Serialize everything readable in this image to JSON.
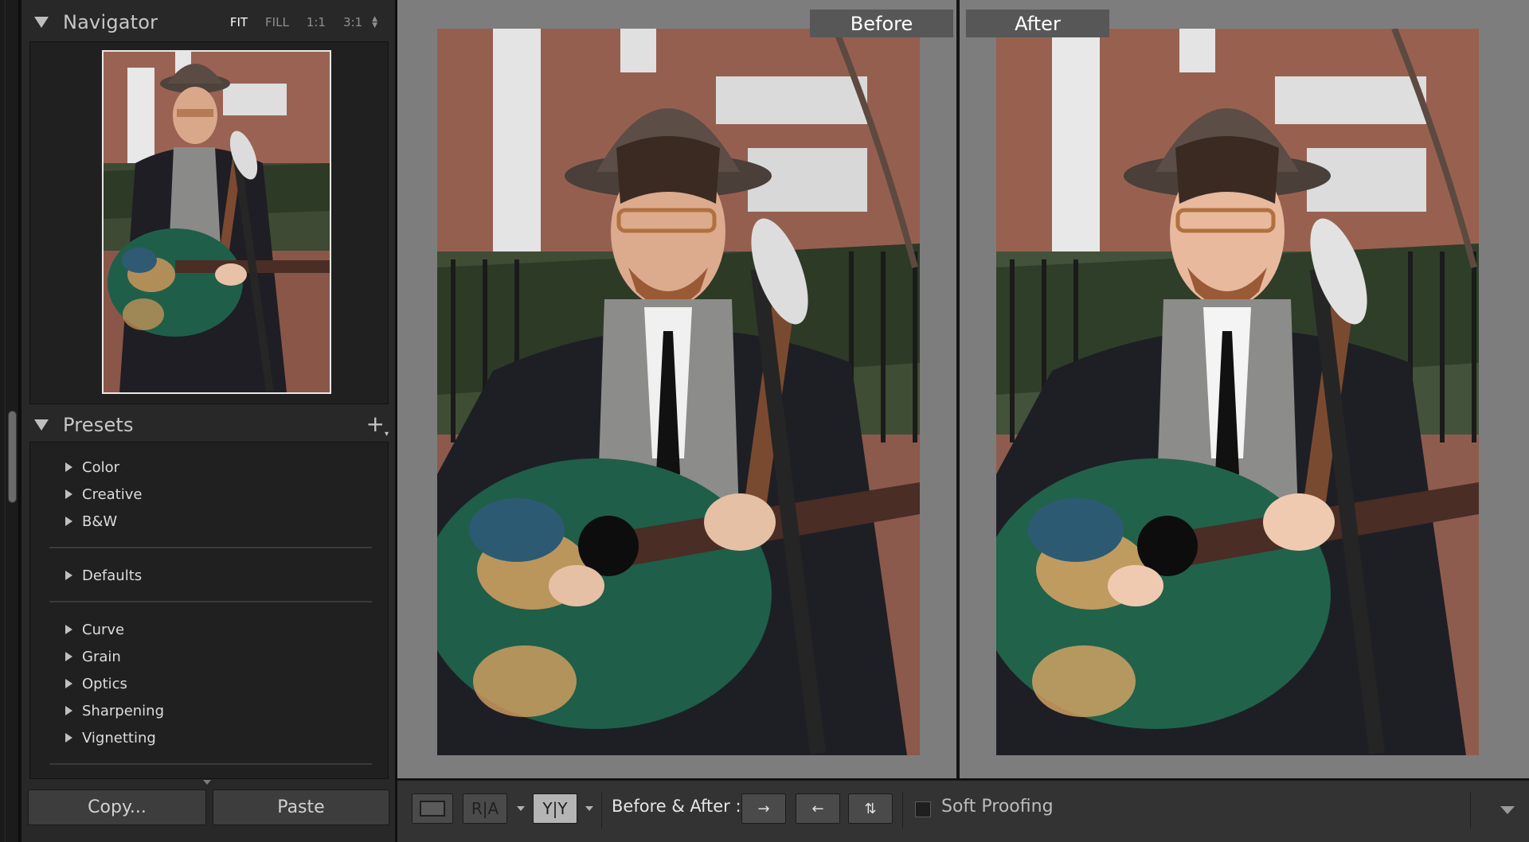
{
  "navigator": {
    "title": "Navigator",
    "modes": [
      "FIT",
      "FILL",
      "1:1",
      "3:1"
    ],
    "active_mode": "FIT"
  },
  "presets": {
    "title": "Presets",
    "add_icon": "plus-icon",
    "groups": [
      [
        "Color",
        "Creative",
        "B&W"
      ],
      [
        "Defaults"
      ],
      [
        "Curve",
        "Grain",
        "Optics",
        "Sharpening",
        "Vignetting"
      ]
    ]
  },
  "buttons": {
    "copy": "Copy...",
    "paste": "Paste"
  },
  "views": {
    "before": "Before",
    "after": "After"
  },
  "toolbar": {
    "view_icon": "loupe-view-icon",
    "ra_label": "R|A",
    "yy_label": "Y|Y",
    "before_after_label": "Before & After :",
    "swap_icons": [
      "copy-before-to-after-icon",
      "copy-after-to-before-icon",
      "swap-before-after-icon"
    ],
    "soft_proofing": "Soft Proofing"
  },
  "colors": {
    "panel": "#282828",
    "panel_inner": "#202020",
    "canvas": "#7d7d7d",
    "label_bg": "#575757"
  }
}
